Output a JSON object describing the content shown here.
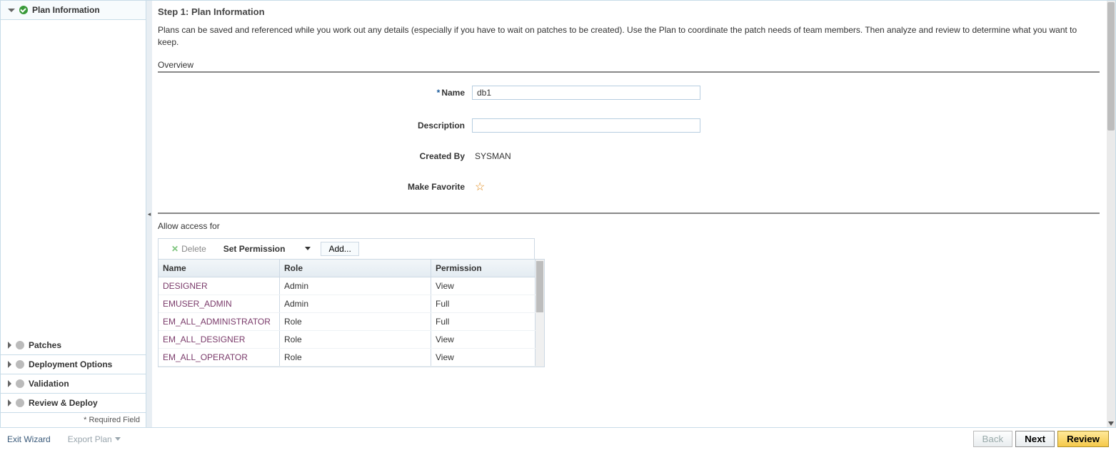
{
  "sidebar": {
    "steps": [
      {
        "label": "Plan Information",
        "status": "ok",
        "expanded": true
      },
      {
        "label": "Patches",
        "status": "none",
        "expanded": false
      },
      {
        "label": "Deployment Options",
        "status": "none",
        "expanded": false
      },
      {
        "label": "Validation",
        "status": "none",
        "expanded": false
      },
      {
        "label": "Review & Deploy",
        "status": "none",
        "expanded": false
      }
    ],
    "required_note": "* Required Field"
  },
  "header": {
    "title": "Step 1: Plan Information",
    "intro": "Plans can be saved and referenced while you work out any details (especially if you have to wait on patches to be created). Use the Plan to coordinate the patch needs of team members. Then analyze and review to determine what you want to keep."
  },
  "overview": {
    "section_label": "Overview",
    "name_label": "Name",
    "name_value": "db1",
    "description_label": "Description",
    "description_value": "",
    "created_by_label": "Created By",
    "created_by_value": "SYSMAN",
    "favorite_label": "Make Favorite"
  },
  "access": {
    "section_label": "Allow access for",
    "toolbar": {
      "delete_label": "Delete",
      "set_permission_label": "Set Permission",
      "add_label": "Add..."
    },
    "columns": {
      "name": "Name",
      "role": "Role",
      "permission": "Permission"
    },
    "rows": [
      {
        "name": "DESIGNER",
        "role": "Admin",
        "permission": "View"
      },
      {
        "name": "EMUSER_ADMIN",
        "role": "Admin",
        "permission": "Full"
      },
      {
        "name": "EM_ALL_ADMINISTRATOR",
        "role": "Role",
        "permission": "Full"
      },
      {
        "name": "EM_ALL_DESIGNER",
        "role": "Role",
        "permission": "View"
      },
      {
        "name": "EM_ALL_OPERATOR",
        "role": "Role",
        "permission": "View"
      }
    ]
  },
  "footer": {
    "exit_label": "Exit Wizard",
    "export_label": "Export Plan",
    "back_label": "Back",
    "next_label": "Next",
    "review_label": "Review"
  }
}
